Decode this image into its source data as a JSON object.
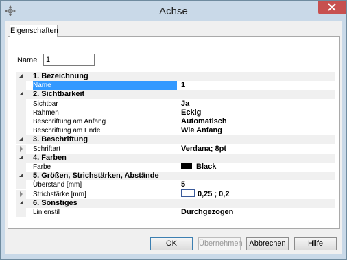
{
  "window": {
    "title": "Achse"
  },
  "tabs": [
    {
      "label": "Eigenschaften"
    }
  ],
  "name_field": {
    "label": "Name",
    "value": "1"
  },
  "grid": {
    "rows": [
      {
        "kind": "cat",
        "label": "1. Bezeichnung"
      },
      {
        "kind": "prop",
        "name": "Name",
        "value": "1",
        "selected": true
      },
      {
        "kind": "cat",
        "label": "2. Sichtbarkeit"
      },
      {
        "kind": "prop",
        "name": "Sichtbar",
        "value": "Ja"
      },
      {
        "kind": "prop",
        "name": "Rahmen",
        "value": "Eckig"
      },
      {
        "kind": "prop",
        "name": "Beschriftung am Anfang",
        "value": "Automatisch"
      },
      {
        "kind": "prop",
        "name": "Beschriftung am Ende",
        "value": "Wie Anfang"
      },
      {
        "kind": "cat",
        "label": "3. Beschriftung"
      },
      {
        "kind": "prop",
        "name": "Schriftart",
        "value": "Verdana; 8pt",
        "expandable": true
      },
      {
        "kind": "cat",
        "label": "4. Farben"
      },
      {
        "kind": "prop",
        "name": "Farbe",
        "value": "Black",
        "swatch": "#000000"
      },
      {
        "kind": "cat",
        "label": "5. Größen, Strichstärken, Abstände"
      },
      {
        "kind": "prop",
        "name": "Überstand [mm]",
        "value": "5"
      },
      {
        "kind": "prop",
        "name": "Strichstärke [mm]",
        "value": "0,25 ; 0,2",
        "expandable": true,
        "linebox": true
      },
      {
        "kind": "cat",
        "label": "6. Sonstiges"
      },
      {
        "kind": "prop",
        "name": "Linienstil",
        "value": "Durchgezogen"
      }
    ]
  },
  "buttons": {
    "ok": "OK",
    "apply": "Übernehmen",
    "cancel": "Abbrechen",
    "help": "Hilfe"
  },
  "colors": {
    "frame": "#c9d9e8",
    "close": "#c7504f",
    "selection": "#3399ff"
  }
}
